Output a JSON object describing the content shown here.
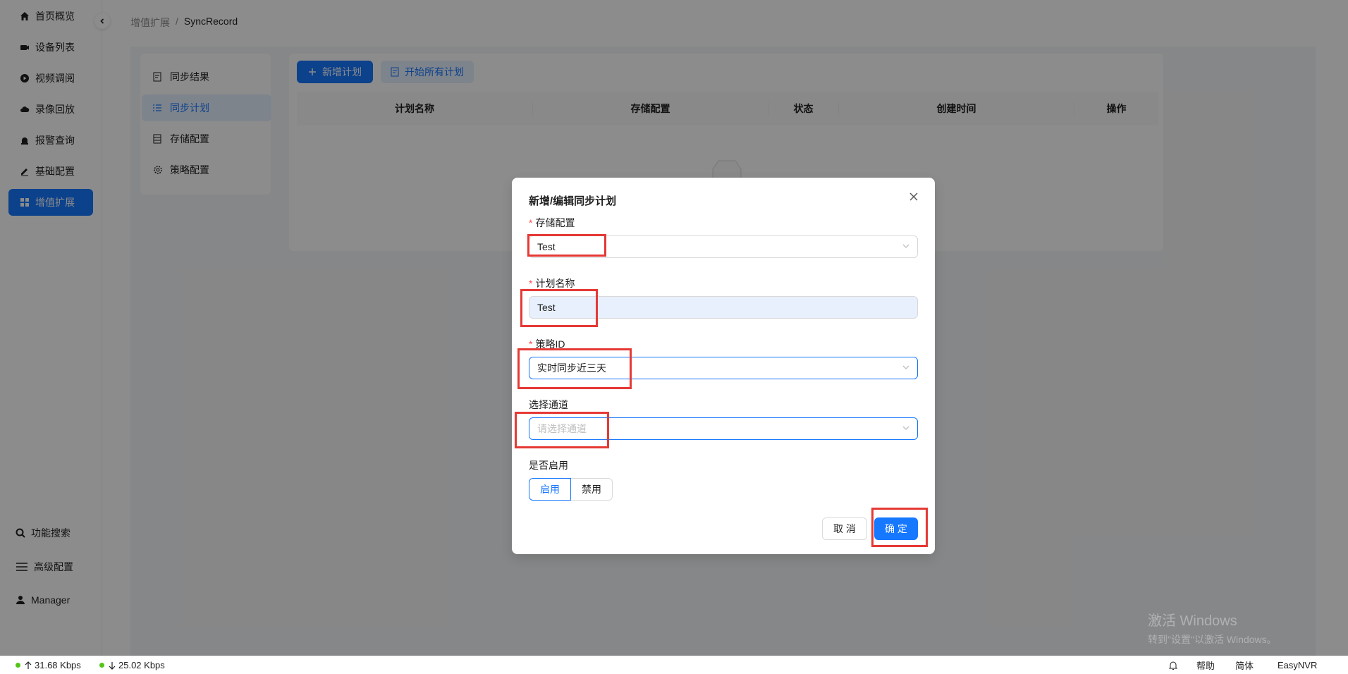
{
  "sidebar": {
    "items": [
      {
        "label": "首页概览",
        "icon": "home-icon"
      },
      {
        "label": "设备列表",
        "icon": "camera-icon"
      },
      {
        "label": "视频调阅",
        "icon": "play-icon"
      },
      {
        "label": "录像回放",
        "icon": "cloud-icon"
      },
      {
        "label": "报警查询",
        "icon": "alarm-icon"
      },
      {
        "label": "基础配置",
        "icon": "pen-icon"
      },
      {
        "label": "增值扩展",
        "icon": "grid-icon",
        "active": true
      }
    ],
    "bottom": {
      "search": "功能搜索",
      "advanced": "高级配置",
      "user": "Manager"
    }
  },
  "breadcrumb": {
    "parent": "增值扩展",
    "separator": "/",
    "current": "SyncRecord"
  },
  "submenu": {
    "items": [
      {
        "label": "同步结果"
      },
      {
        "label": "同步计划",
        "active": true
      },
      {
        "label": "存储配置"
      },
      {
        "label": "策略配置"
      }
    ]
  },
  "toolbar": {
    "add_plan": "新增计划",
    "start_all": "开始所有计划"
  },
  "table": {
    "columns": [
      "计划名称",
      "存储配置",
      "状态",
      "创建时间",
      "操作"
    ]
  },
  "modal": {
    "title": "新增/编辑同步计划",
    "storage_label": "存储配置",
    "storage_value": "Test",
    "plan_name_label": "计划名称",
    "plan_name_value": "Test",
    "policy_label": "策略ID",
    "policy_value": "实时同步近三天",
    "channel_label": "选择通道",
    "channel_placeholder": "请选择通道",
    "enable_label": "是否启用",
    "enable_on": "启用",
    "enable_off": "禁用",
    "cancel": "取 消",
    "confirm": "确 定",
    "required_mark": "*"
  },
  "status": {
    "upload": "31.68 Kbps",
    "download": "25.02 Kbps",
    "help": "帮助",
    "lang": "简体",
    "product": "EasyNVR"
  },
  "watermark": {
    "line1": "激活 Windows",
    "line2": "转到\"设置\"以激活 Windows。"
  },
  "colors": {
    "primary": "#1677ff",
    "annotation": "#e53935",
    "status_dot": "#52c41a"
  }
}
